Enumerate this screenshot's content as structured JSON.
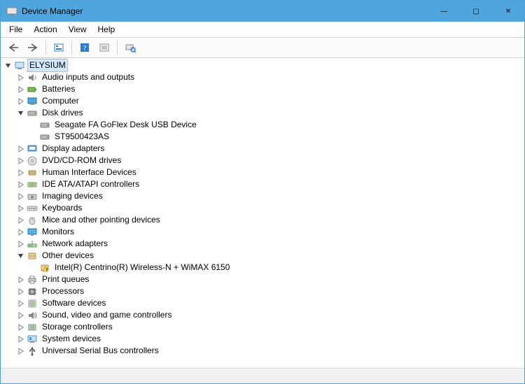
{
  "titlebar": {
    "title": "Device Manager",
    "buttons": {
      "min": "—",
      "max": "▢",
      "close": "✕"
    }
  },
  "menu": {
    "items": [
      "File",
      "Action",
      "View",
      "Help"
    ]
  },
  "toolbar": {
    "buttons": [
      "back",
      "forward",
      "show-hidden",
      "help",
      "properties",
      "scan"
    ]
  },
  "tree": {
    "root": {
      "label": "ELYSIUM",
      "icon": "computer",
      "expanded": true,
      "selected": true
    },
    "nodes": [
      {
        "label": "Audio inputs and outputs",
        "icon": "audio",
        "expanded": false,
        "children": []
      },
      {
        "label": "Batteries",
        "icon": "battery",
        "expanded": false,
        "children": []
      },
      {
        "label": "Computer",
        "icon": "computer-node",
        "expanded": false,
        "children": []
      },
      {
        "label": "Disk drives",
        "icon": "disk",
        "expanded": true,
        "children": [
          {
            "label": "Seagate FA GoFlex Desk USB Device",
            "icon": "disk"
          },
          {
            "label": "ST9500423AS",
            "icon": "disk"
          }
        ]
      },
      {
        "label": "Display adapters",
        "icon": "display",
        "expanded": false,
        "children": []
      },
      {
        "label": "DVD/CD-ROM drives",
        "icon": "cdrom",
        "expanded": false,
        "children": []
      },
      {
        "label": "Human Interface Devices",
        "icon": "hid",
        "expanded": false,
        "children": []
      },
      {
        "label": "IDE ATA/ATAPI controllers",
        "icon": "ide",
        "expanded": false,
        "children": []
      },
      {
        "label": "Imaging devices",
        "icon": "imaging",
        "expanded": false,
        "children": []
      },
      {
        "label": "Keyboards",
        "icon": "keyboard",
        "expanded": false,
        "children": []
      },
      {
        "label": "Mice and other pointing devices",
        "icon": "mouse",
        "expanded": false,
        "children": []
      },
      {
        "label": "Monitors",
        "icon": "monitor",
        "expanded": false,
        "children": []
      },
      {
        "label": "Network adapters",
        "icon": "network",
        "expanded": false,
        "children": []
      },
      {
        "label": "Other devices",
        "icon": "other",
        "expanded": true,
        "children": [
          {
            "label": "Intel(R) Centrino(R) Wireless-N + WiMAX 6150",
            "icon": "warning"
          }
        ]
      },
      {
        "label": "Print queues",
        "icon": "printer",
        "expanded": false,
        "children": []
      },
      {
        "label": "Processors",
        "icon": "cpu",
        "expanded": false,
        "children": []
      },
      {
        "label": "Software devices",
        "icon": "software",
        "expanded": false,
        "children": []
      },
      {
        "label": "Sound, video and game controllers",
        "icon": "sound",
        "expanded": false,
        "children": []
      },
      {
        "label": "Storage controllers",
        "icon": "storage",
        "expanded": false,
        "children": []
      },
      {
        "label": "System devices",
        "icon": "system",
        "expanded": false,
        "children": []
      },
      {
        "label": "Universal Serial Bus controllers",
        "icon": "usb",
        "expanded": false,
        "children": []
      }
    ]
  }
}
